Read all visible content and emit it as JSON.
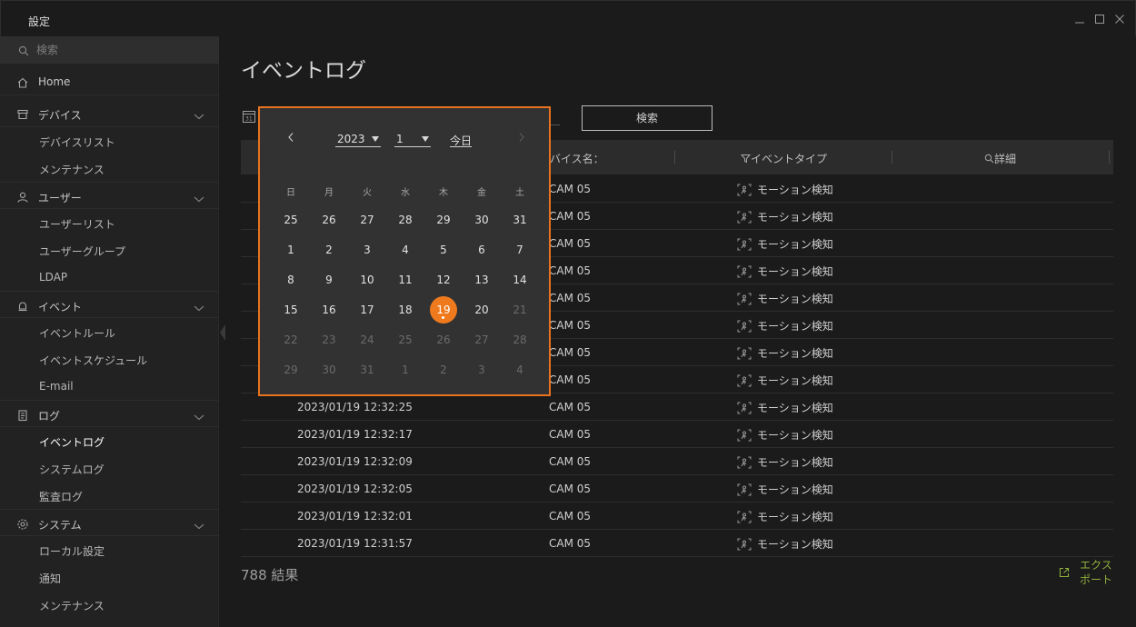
{
  "window": {
    "title": "設定",
    "controls": [
      "minimize-icon",
      "maximize-icon",
      "close-icon"
    ]
  },
  "sidebar": {
    "search_placeholder": "検索",
    "home": "Home",
    "groups": [
      {
        "label": "デバイス",
        "icon": "device-icon",
        "items": [
          "デバイスリスト",
          "メンテナンス"
        ]
      },
      {
        "label": "ユーザー",
        "icon": "user-icon",
        "items": [
          "ユーザーリスト",
          "ユーザーグループ",
          "LDAP"
        ]
      },
      {
        "label": "イベント",
        "icon": "bell-icon",
        "items": [
          "イベントルール",
          "イベントスケジュール",
          "E-mail"
        ]
      },
      {
        "label": "ログ",
        "icon": "log-icon",
        "items": [
          "イベントログ",
          "システムログ",
          "監査ログ"
        ]
      },
      {
        "label": "システム",
        "icon": "gear-icon",
        "items": [
          "ローカル設定",
          "通知",
          "メンテナンス"
        ]
      }
    ],
    "active_item": "イベントログ"
  },
  "main": {
    "title": "イベントログ",
    "search_button": "検索",
    "columns": {
      "device": "バイス名：",
      "event_type": "イベントタイプ",
      "detail": "詳細"
    },
    "rows": [
      {
        "time": "",
        "device": "CAM 05",
        "type": "モーション検知"
      },
      {
        "time": "",
        "device": "CAM 05",
        "type": "モーション検知"
      },
      {
        "time": "",
        "device": "CAM 05",
        "type": "モーション検知"
      },
      {
        "time": "",
        "device": "CAM 05",
        "type": "モーション検知"
      },
      {
        "time": "",
        "device": "CAM 05",
        "type": "モーション検知"
      },
      {
        "time": "",
        "device": "CAM 05",
        "type": "モーション検知"
      },
      {
        "time": "",
        "device": "CAM 05",
        "type": "モーション検知"
      },
      {
        "time": "",
        "device": "CAM 05",
        "type": "モーション検知"
      },
      {
        "time": "2023/01/19 12:32:25",
        "device": "CAM 05",
        "type": "モーション検知"
      },
      {
        "time": "2023/01/19 12:32:17",
        "device": "CAM 05",
        "type": "モーション検知"
      },
      {
        "time": "2023/01/19 12:32:09",
        "device": "CAM 05",
        "type": "モーション検知"
      },
      {
        "time": "2023/01/19 12:32:05",
        "device": "CAM 05",
        "type": "モーション検知"
      },
      {
        "time": "2023/01/19 12:32:01",
        "device": "CAM 05",
        "type": "モーション検知"
      },
      {
        "time": "2023/01/19 12:31:57",
        "device": "CAM 05",
        "type": "モーション検知"
      }
    ],
    "results": "788 結果",
    "export_label": "エクスポート",
    "export_lines": [
      "エクス",
      "ポート"
    ]
  },
  "calendar": {
    "year": "2023",
    "month": "1",
    "today_label": "今日",
    "weekdays": [
      "日",
      "月",
      "火",
      "水",
      "木",
      "金",
      "土"
    ],
    "weeks": [
      [
        "25",
        "26",
        "27",
        "28",
        "29",
        "30",
        "31"
      ],
      [
        "1",
        "2",
        "3",
        "4",
        "5",
        "6",
        "7"
      ],
      [
        "8",
        "9",
        "10",
        "11",
        "12",
        "13",
        "14"
      ],
      [
        "15",
        "16",
        "17",
        "18",
        "19",
        "20",
        "21"
      ],
      [
        "22",
        "23",
        "24",
        "25",
        "26",
        "27",
        "28"
      ],
      [
        "29",
        "30",
        "31",
        "1",
        "2",
        "3",
        "4"
      ]
    ],
    "selected_day": "19",
    "accent_color": "#ef7a1e"
  }
}
